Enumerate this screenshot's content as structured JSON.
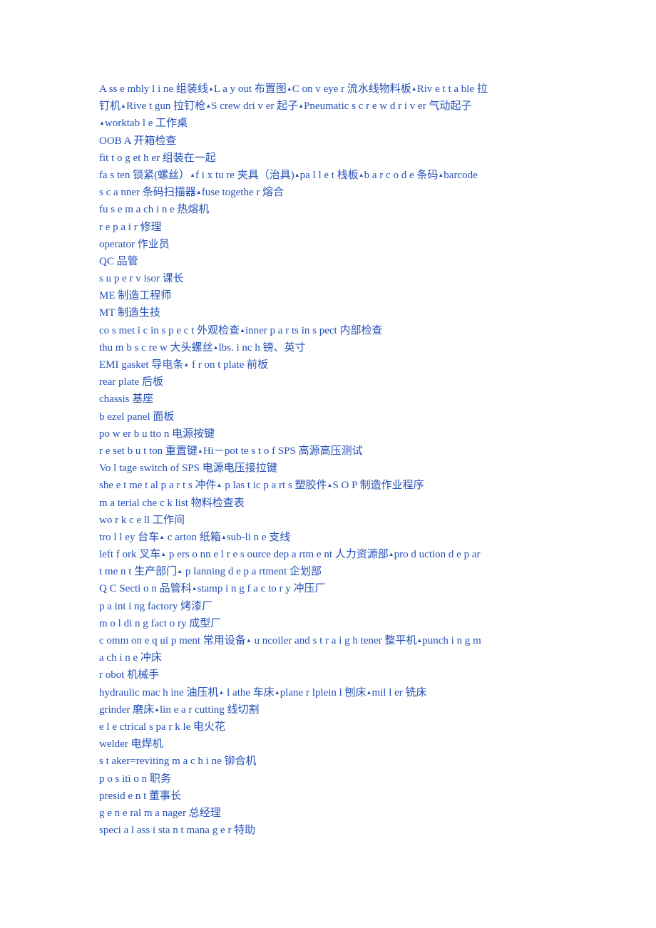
{
  "document": {
    "separator_icon": "triangle-marker-icon",
    "separator_glyph": "▲",
    "text_color": "#2450b8",
    "lines": [
      "A ss e mbly l i ne  组装线▲L a y out  布置图▲C on v eye r     流水线物料板▲Riv e t t a ble  拉",
      "钉机▲Rive t   gun    拉钉枪▲S crew dri v er  起子▲Pneumatic s c  r e w      d r i  v er  气动起子",
      "▲worktab l e  工作桌",
      "OOB A   开箱检查",
      "fit     t o g et h er  组装在一起",
      "fa s ten  锁紧(螺丝）▲f  i  x tu re    夹具（治具)▲pa l l e t    栈板▲b  a  r c o  d e     条码▲barcode",
      " s c a nner  条码扫描器▲fuse togethe r     熔合",
      "fu s e    m a ch i n e 热熔机",
      "r e  p a i r 修理",
      "operator 作业员",
      "QC 品管",
      " s  u p e r v isor  课长",
      "ME  制造工程师",
      "MT  制造生技",
      "co s met i c in s p e  c t  外观检查▲inner     p  a  r ts in s pect    内部检查",
      "thu m b s c re w     大头螺丝▲lbs.   i nc h   镑、英寸",
      "EMI gasket  导电条▲ f   r on  t    plate  前板",
      "rear plate  后板",
      "chassis    基座",
      " b ezel panel  面板",
      "po w er     b u tto n   电源按键",
      "r e set    b  u t ton  重置键▲Hi－pot te s t o f    SPS  高源高压测试",
      "Vo l tage     switch of     SPS  电源电压接拉键",
      "she e t me t al p a r t  s   冲件▲ p las t ic p a rt s    塑胶件▲S O P   制造作业程序",
      "m a terial     che c k    list  物料检查表",
      "wo r k    c e ll  工作间",
      "tro l  l ey    台车▲ c arton  纸箱▲sub-li n e  支线",
      "left     f ork  叉车▲ p ers o nn e l   r e s ource dep a rtm e nt  人力资源部▲pro d uction    d e p ar",
      " t me n t 生产部门▲ p lanning d e  p  a rtment 企划部",
      " Q C   Secti o n 品管科▲stamp i n g   f a  c to r  y 冲压厂",
      " p  a int  i  ng     factory 烤漆厂",
      "m o  l di n  g      fact o ry 成型厂",
      " c omm on     e q ui p ment 常用设备▲ u ncoiler and    s t r a i g h tener 整平机▲punch  i  n g     m",
      " a ch  i  n e  冲床",
      " r obot 机械手",
      "hydraulic     mac h ine 油压机▲ l athe 车床▲plane r   lplein l 刨床▲mil l er 铣床",
      "grinder 磨床▲lin e a r     cutting 线切割",
      "e  l  e ctrical     s pa r  k le 电火花",
      "welder 电焊机",
      "s  t aker=reviting m a c h   i ne 铆合机",
      "p  o   s iti o n 职务",
      "presid e  n t 董事长",
      "g e n e ral     m a nager 总经理",
      "speci a   l     ass  i  sta n  t     mana g e r 特助"
    ]
  }
}
